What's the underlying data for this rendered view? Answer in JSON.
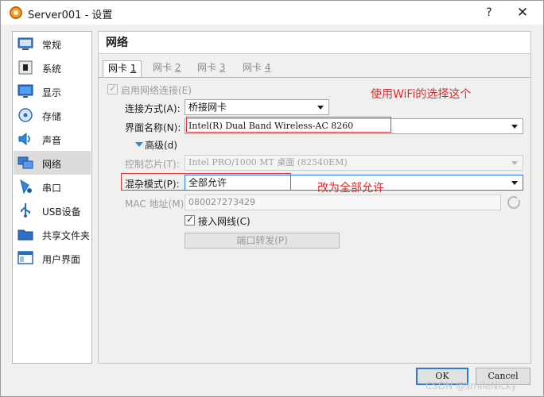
{
  "window": {
    "title": "Server001 - 设置",
    "help_glyph": "?",
    "close_glyph": "✕"
  },
  "sidebar": {
    "items": [
      {
        "label": "常规",
        "icon": "general-settings-icon"
      },
      {
        "label": "系统",
        "icon": "system-chip-icon"
      },
      {
        "label": "显示",
        "icon": "display-monitor-icon"
      },
      {
        "label": "存储",
        "icon": "storage-disk-icon"
      },
      {
        "label": "声音",
        "icon": "speaker-icon"
      },
      {
        "label": "网络",
        "icon": "network-icon",
        "selected": true
      },
      {
        "label": "串口",
        "icon": "serial-port-icon"
      },
      {
        "label": "USB设备",
        "icon": "usb-icon"
      },
      {
        "label": "共享文件夹",
        "icon": "shared-folder-icon"
      },
      {
        "label": "用户界面",
        "icon": "user-interface-icon"
      }
    ]
  },
  "main": {
    "title": "网络",
    "tabs": [
      {
        "label": "网卡 ",
        "num": "1",
        "active": true
      },
      {
        "label": "网卡 ",
        "num": "2",
        "active": false
      },
      {
        "label": "网卡 ",
        "num": "3",
        "active": false
      },
      {
        "label": "网卡 ",
        "num": "4",
        "active": false
      }
    ]
  },
  "form": {
    "enable_label": "启用网络连接(E)",
    "enable_checked": true,
    "attached_label": "连接方式(A):",
    "attached_value": "桥接网卡",
    "name_label": "界面名称(N):",
    "name_value": "Intel(R) Dual Band Wireless-AC 8260",
    "advanced_label": "高级(d)",
    "adapter_label": "控制芯片(T):",
    "adapter_value": "Intel PRO/1000 MT 桌面 (82540EM)",
    "promisc_label": "混杂模式(P):",
    "promisc_value": "全部允许",
    "mac_label": "MAC 地址(M):",
    "mac_value": "080027273429",
    "cable_label": "接入网线(C)",
    "cable_checked": true,
    "port_forward_label": "端口转发(P)"
  },
  "annotations": {
    "wifi_note": "使用WiFi的选择这个",
    "promisc_note": "改为全部允许",
    "color": "#e0282a"
  },
  "dialog_buttons": {
    "ok": "OK",
    "cancel": "Cancel"
  },
  "watermark": "CSDN @smileNicky",
  "colors": {
    "accent": "#2b79d8",
    "annotation": "#e0282a"
  }
}
